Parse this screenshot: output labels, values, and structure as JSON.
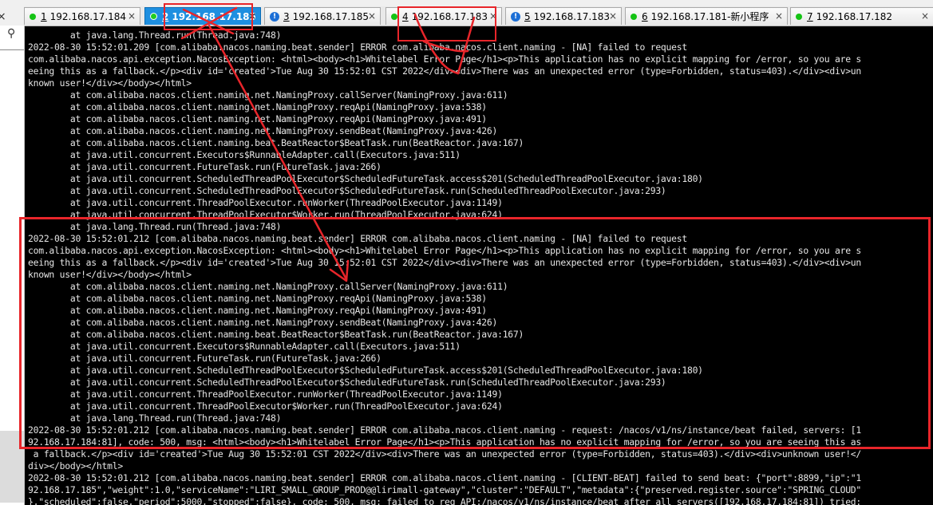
{
  "tabs": [
    {
      "num": "1",
      "label": "192.168.17.184",
      "status": "connected",
      "active": false
    },
    {
      "num": "2",
      "label": "192.168.17.185",
      "status": "connected",
      "active": true
    },
    {
      "num": "3",
      "label": "192.168.17.185",
      "status": "warning",
      "active": false
    },
    {
      "num": "4",
      "label": "192.168.17.183",
      "status": "connected",
      "active": false
    },
    {
      "num": "5",
      "label": "192.168.17.183",
      "status": "warning",
      "active": false
    },
    {
      "num": "6",
      "label": "192.168.17.181-新小程序",
      "status": "connected",
      "active": false
    },
    {
      "num": "7",
      "label": "192.168.17.182",
      "status": "connected",
      "active": false
    }
  ],
  "tab_close_glyph": "×",
  "sidebar": {
    "search_icon": "magnifier-icon"
  },
  "terminal_lines": [
    "        at java.lang.Thread.run(Thread.java:748)",
    "2022-08-30 15:52:01.209 [com.alibaba.nacos.naming.beat.sender] ERROR com.alibaba.nacos.client.naming - [NA] failed to request",
    "com.alibaba.nacos.api.exception.NacosException: <html><body><h1>Whitelabel Error Page</h1><p>This application has no explicit mapping for /error, so you are s",
    "eeing this as a fallback.</p><div id='created'>Tue Aug 30 15:52:01 CST 2022</div><div>There was an unexpected error (type=Forbidden, status=403).</div><div>un",
    "known user!</div></body></html>",
    "        at com.alibaba.nacos.client.naming.net.NamingProxy.callServer(NamingProxy.java:611)",
    "        at com.alibaba.nacos.client.naming.net.NamingProxy.reqApi(NamingProxy.java:538)",
    "        at com.alibaba.nacos.client.naming.net.NamingProxy.reqApi(NamingProxy.java:491)",
    "        at com.alibaba.nacos.client.naming.net.NamingProxy.sendBeat(NamingProxy.java:426)",
    "        at com.alibaba.nacos.client.naming.beat.BeatReactor$BeatTask.run(BeatReactor.java:167)",
    "        at java.util.concurrent.Executors$RunnableAdapter.call(Executors.java:511)",
    "        at java.util.concurrent.FutureTask.run(FutureTask.java:266)",
    "        at java.util.concurrent.ScheduledThreadPoolExecutor$ScheduledFutureTask.access$201(ScheduledThreadPoolExecutor.java:180)",
    "        at java.util.concurrent.ScheduledThreadPoolExecutor$ScheduledFutureTask.run(ScheduledThreadPoolExecutor.java:293)",
    "        at java.util.concurrent.ThreadPoolExecutor.runWorker(ThreadPoolExecutor.java:1149)",
    "        at java.util.concurrent.ThreadPoolExecutor$Worker.run(ThreadPoolExecutor.java:624)",
    "        at java.lang.Thread.run(Thread.java:748)",
    "2022-08-30 15:52:01.212 [com.alibaba.nacos.naming.beat.sender] ERROR com.alibaba.nacos.client.naming - [NA] failed to request",
    "com.alibaba.nacos.api.exception.NacosException: <html><body><h1>Whitelabel Error Page</h1><p>This application has no explicit mapping for /error, so you are s",
    "eeing this as a fallback.</p><div id='created'>Tue Aug 30 15:52:01 CST 2022</div><div>There was an unexpected error (type=Forbidden, status=403).</div><div>un",
    "known user!</div></body></html>",
    "        at com.alibaba.nacos.client.naming.net.NamingProxy.callServer(NamingProxy.java:611)",
    "        at com.alibaba.nacos.client.naming.net.NamingProxy.reqApi(NamingProxy.java:538)",
    "        at com.alibaba.nacos.client.naming.net.NamingProxy.reqApi(NamingProxy.java:491)",
    "        at com.alibaba.nacos.client.naming.net.NamingProxy.sendBeat(NamingProxy.java:426)",
    "        at com.alibaba.nacos.client.naming.beat.BeatReactor$BeatTask.run(BeatReactor.java:167)",
    "        at java.util.concurrent.Executors$RunnableAdapter.call(Executors.java:511)",
    "        at java.util.concurrent.FutureTask.run(FutureTask.java:266)",
    "        at java.util.concurrent.ScheduledThreadPoolExecutor$ScheduledFutureTask.access$201(ScheduledThreadPoolExecutor.java:180)",
    "        at java.util.concurrent.ScheduledThreadPoolExecutor$ScheduledFutureTask.run(ScheduledThreadPoolExecutor.java:293)",
    "        at java.util.concurrent.ThreadPoolExecutor.runWorker(ThreadPoolExecutor.java:1149)",
    "        at java.util.concurrent.ThreadPoolExecutor$Worker.run(ThreadPoolExecutor.java:624)",
    "        at java.lang.Thread.run(Thread.java:748)",
    "2022-08-30 15:52:01.212 [com.alibaba.nacos.naming.beat.sender] ERROR com.alibaba.nacos.client.naming - request: /nacos/v1/ns/instance/beat failed, servers: [1",
    "92.168.17.184:81], code: 500, msg: <html><body><h1>Whitelabel Error Page</h1><p>This application has no explicit mapping for /error, so you are seeing this as",
    " a fallback.</p><div id='created'>Tue Aug 30 15:52:01 CST 2022</div><div>There was an unexpected error (type=Forbidden, status=403).</div><div>unknown user!</",
    "div></body></html>",
    "2022-08-30 15:52:01.212 [com.alibaba.nacos.naming.beat.sender] ERROR com.alibaba.nacos.client.naming - [CLIENT-BEAT] failed to send beat: {\"port\":8899,\"ip\":\"1",
    "92.168.17.185\",\"weight\":1.0,\"serviceName\":\"LIRI_SMALL_GROUP_PROD@@lirimall-gateway\",\"cluster\":\"DEFAULT\",\"metadata\":{\"preserved.register.source\":\"SPRING_CLOUD\"",
    "},\"scheduled\":false,\"period\":5000,\"stopped\":false}, code: 500, msg: failed to req API:/nacos/v1/ns/instance/beat after all servers([192.168.17.184:81]) tried:"
  ],
  "colors": {
    "annotation": "#e8252a",
    "active_tab": "#1e8fe0",
    "status_connected": "#14c314",
    "status_warning": "#1c6fd6"
  }
}
